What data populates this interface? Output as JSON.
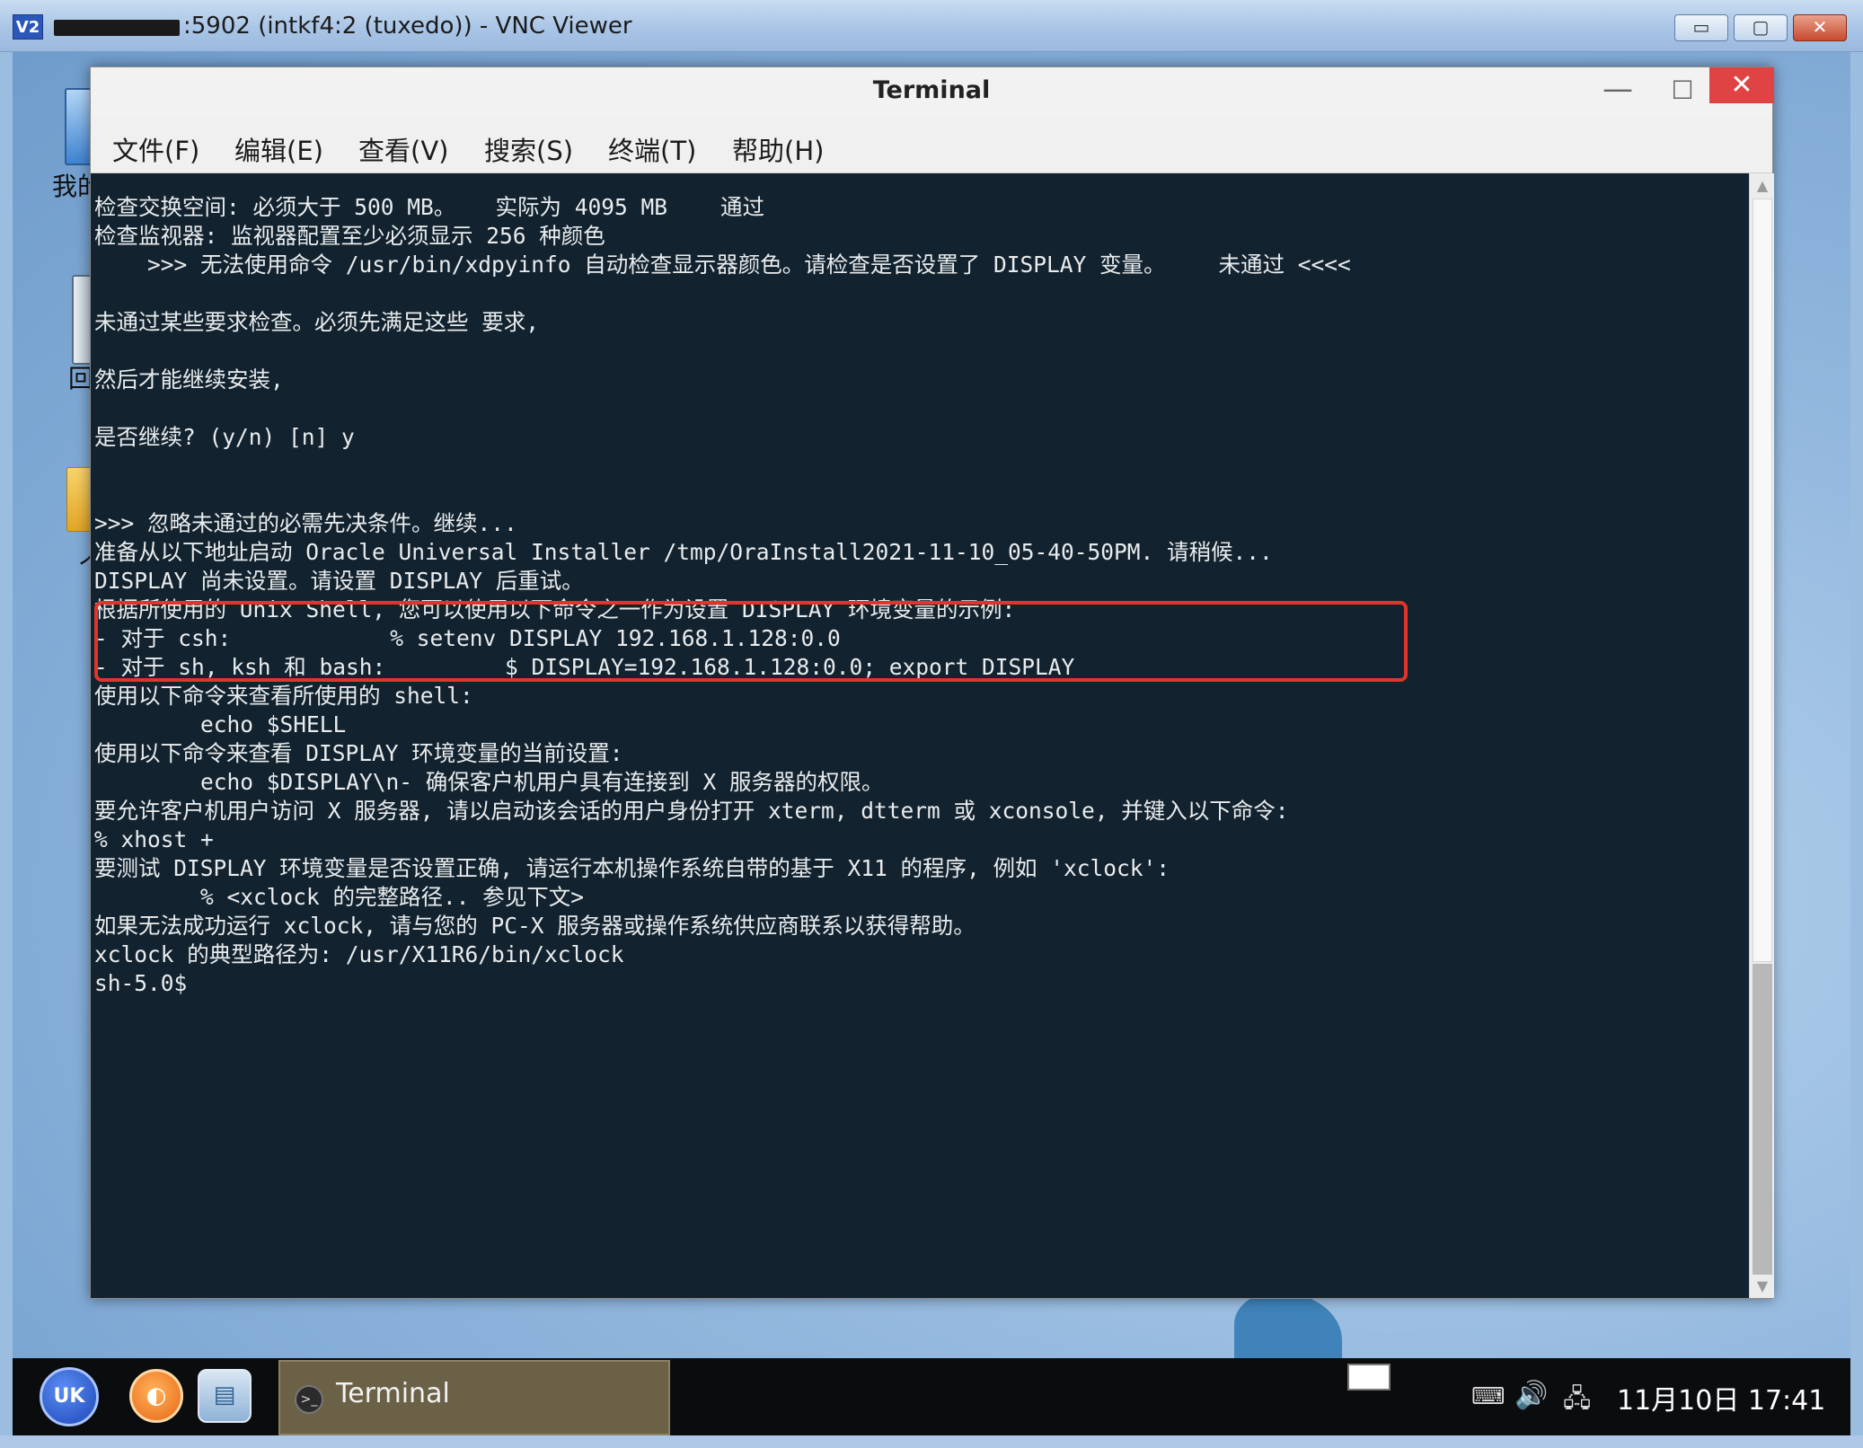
{
  "vnc": {
    "logo": "V2",
    "title": ":5902 (intkf4:2 (tuxedo)) - VNC Viewer",
    "controls": {
      "minimize": "▭",
      "maximize": "▢",
      "close": "✕"
    }
  },
  "desktop": {
    "icons": [
      {
        "label": "我的",
        "icon": "computer-icon"
      },
      {
        "label": "回",
        "icon": "recycle-bin-icon"
      },
      {
        "label": "个",
        "icon": "folder-icon"
      }
    ]
  },
  "terminal": {
    "title": "Terminal",
    "controls": {
      "minimize": "—",
      "maximize": "☐",
      "close": "✕"
    },
    "menu": [
      "文件(F)",
      "编辑(E)",
      "查看(V)",
      "搜索(S)",
      "终端(T)",
      "帮助(H)"
    ],
    "lines": [
      "检查交换空间: 必须大于 500 MB。   实际为 4095 MB    通过",
      "检查监视器: 监视器配置至少必须显示 256 种颜色",
      "    >>> 无法使用命令 /usr/bin/xdpyinfo 自动检查显示器颜色。请检查是否设置了 DISPLAY 变量。    未通过 <<<<",
      "",
      "未通过某些要求检查。必须先满足这些 要求,",
      "",
      "然后才能继续安装,",
      "",
      "是否继续? (y/n) [n] y",
      "",
      "",
      ">>> 忽略未通过的必需先决条件。继续...",
      "准备从以下地址启动 Oracle Universal Installer /tmp/OraInstall2021-11-10_05-40-50PM. 请稍候...",
      "DISPLAY 尚未设置。请设置 DISPLAY 后重试。",
      "根据所使用的 Unix Shell, 您可以使用以下命令之一作为设置 DISPLAY 环境变量的示例:",
      "- 对于 csh:            % setenv DISPLAY 192.168.1.128:0.0",
      "- 对于 sh, ksh 和 bash:         $ DISPLAY=192.168.1.128:0.0; export DISPLAY",
      "使用以下命令来查看所使用的 shell:",
      "        echo $SHELL",
      "使用以下命令来查看 DISPLAY 环境变量的当前设置:",
      "        echo $DISPLAY\\n- 确保客户机用户具有连接到 X 服务器的权限。",
      "要允许客户机用户访问 X 服务器, 请以启动该会话的用户身份打开 xterm, dtterm 或 xconsole, 并键入以下命令:",
      "% xhost +",
      "要测试 DISPLAY 环境变量是否设置正确, 请运行本机操作系统自带的基于 X11 的程序, 例如 'xclock':",
      "        % <xclock 的完整路径.. 参见下文>",
      "如果无法成功运行 xclock, 请与您的 PC-X 服务器或操作系统供应商联系以获得帮助。",
      "xclock 的典型路径为: /usr/X11R6/bin/xclock",
      "sh-5.0$"
    ],
    "highlight_color": "#e0352b",
    "background_color": "#12232f",
    "scroll": {
      "up": "▲",
      "down": "▼"
    }
  },
  "taskbar": {
    "start_label": "UK",
    "browser_glyph": "◐",
    "files_glyph": "▤",
    "active_task": {
      "icon_glyph": ">_",
      "label": "Terminal"
    },
    "tray": {
      "keyboard": "⌨",
      "volume": "🔊",
      "network": "🖧"
    },
    "clock": "11月10日 17:41"
  }
}
